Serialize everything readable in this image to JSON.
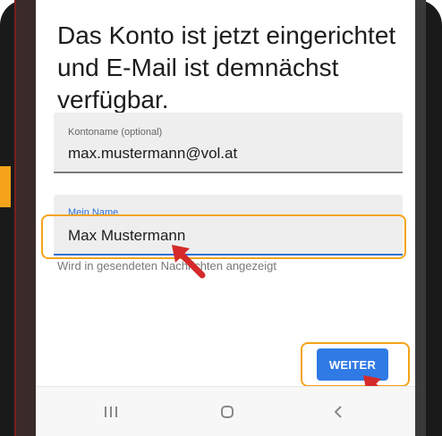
{
  "screen": {
    "heading": "Das Konto ist jetzt eingerichtet und E-Mail ist demnächst verfügbar."
  },
  "fields": {
    "account": {
      "label": "Kontoname (optional)",
      "value": "max.mustermann@vol.at"
    },
    "name": {
      "label": "Mein Name",
      "value": "Max Mustermann",
      "helper": "Wird in gesendeten Nachrichten angezeigt"
    }
  },
  "actions": {
    "next_label": "WEITER"
  },
  "navbar": {
    "recents_icon": "recents-icon",
    "home_icon": "home-icon",
    "back_icon": "back-icon"
  },
  "colors": {
    "accent": "#2f7ae5",
    "highlight": "#f5a31a",
    "arrow": "#d42a2a"
  }
}
